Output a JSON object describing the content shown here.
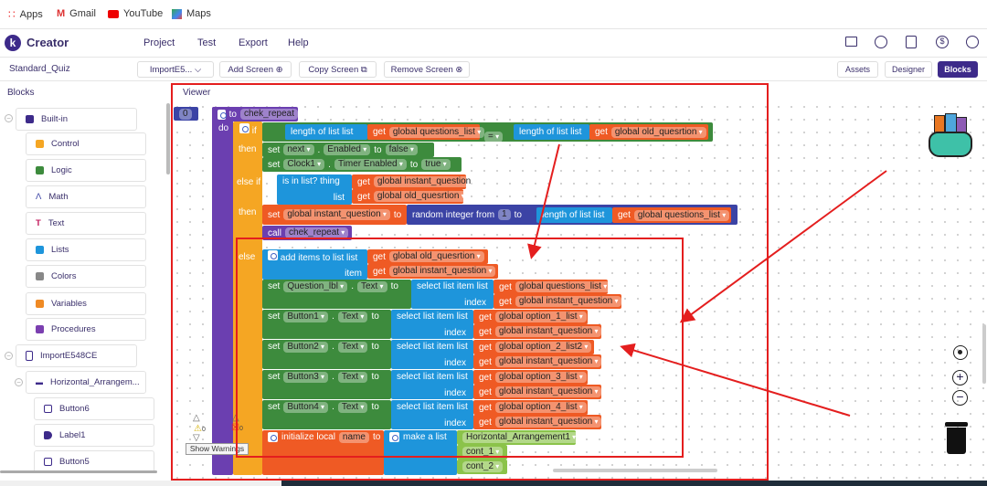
{
  "bookmarks": [
    "Apps",
    "Gmail",
    "YouTube",
    "Maps"
  ],
  "app": {
    "logo_letter": "k",
    "name": "Creator",
    "menu": [
      "Project",
      "Test",
      "Export",
      "Help"
    ],
    "header_icons": [
      "folder-star-icon",
      "gallery-icon",
      "docs-icon",
      "dollar-icon",
      "account-icon"
    ]
  },
  "toolbar": {
    "project": "Standard_Quiz",
    "screen_select": "ImportE5...",
    "add_screen": "Add Screen",
    "copy_screen": "Copy Screen",
    "remove_screen": "Remove Screen",
    "assets": "Assets",
    "designer": "Designer",
    "blocks": "Blocks"
  },
  "sidebar": {
    "title": "Blocks",
    "builtin": "Built-in",
    "items": [
      "Control",
      "Logic",
      "Math",
      "Text",
      "Lists",
      "Colors",
      "Variables",
      "Procedures"
    ],
    "screen": "ImportE548CE",
    "arrangement": "Horizontal_Arrangem...",
    "components": [
      "Button6",
      "Label1",
      "Button5"
    ]
  },
  "viewer": {
    "title": "Viewer",
    "warnings_count": "0",
    "errors_count": "0",
    "show_warnings": "Show Warnings"
  },
  "b": {
    "zero": "0",
    "to": "to",
    "proc": "chek_repeat",
    "do": "do",
    "if": "if",
    "then": "then",
    "else_if": "else if",
    "else": "else",
    "len": "length of list  list",
    "get": "get",
    "eq": "=",
    "g_qlist": "global questions_list",
    "g_old": "global old_quesrtion",
    "g_inst": "global instant_question",
    "set": "set",
    "next": "next",
    "enabled": "Enabled",
    "to2": "to",
    "false": "false",
    "clock": "Clock1",
    "timer": "Timer Enabled",
    "true": "true",
    "isin": "is in list? thing",
    "list": "list",
    "rand": "random integer from",
    "one": "1",
    "call": "call",
    "add": "add items to list   list",
    "item": "item",
    "qlbl": "Question_lbl",
    "text": "Text",
    "select": "select list item  list",
    "index": "index",
    "btn1": "Button1",
    "btn2": "Button2",
    "btn3": "Button3",
    "btn4": "Button4",
    "o1": "global option_1_list",
    "o2": "global option_2_list2",
    "o3": "global option_3_list",
    "o4": "global option_4_list",
    "init": "initialize local",
    "name": "name",
    "make": "make a list",
    "ha": "Horizontal_Arrangement1",
    "c1": "cont_1",
    "c2": "cont_2"
  },
  "colors": {
    "accent": "#3d2a8a",
    "annotation": "#e41e1e",
    "procedure": "#6b3fb0",
    "control": "#f5a623",
    "logic": "#3d8b3d",
    "lists": "#1e95db",
    "variables": "#ef5a24",
    "math": "#3b43a5"
  }
}
